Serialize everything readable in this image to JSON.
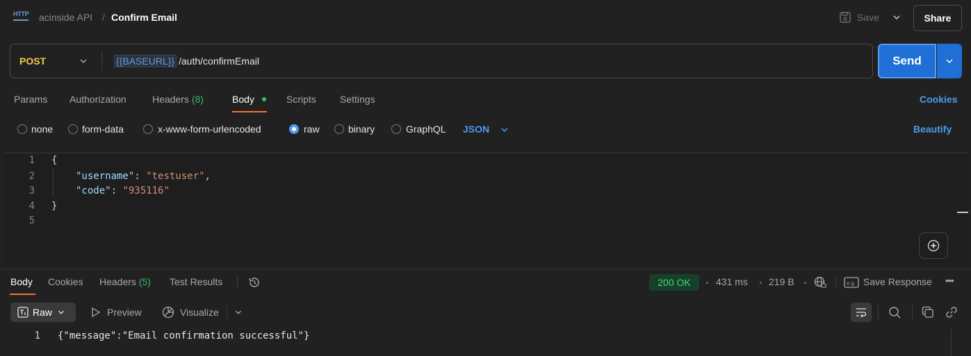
{
  "header": {
    "protocol_badge": "HTTP",
    "collection": "acinside API",
    "separator": "/",
    "request_name": "Confirm Email",
    "save_label": "Save",
    "share_label": "Share"
  },
  "url_bar": {
    "method": "POST",
    "variable": "{{BASEURL}}",
    "path": "/auth/confirmEmail",
    "send_label": "Send"
  },
  "request_tabs": {
    "params": "Params",
    "authorization": "Authorization",
    "headers": "Headers",
    "headers_count": "(8)",
    "body": "Body",
    "scripts": "Scripts",
    "settings": "Settings",
    "cookies": "Cookies"
  },
  "body_types": {
    "none": "none",
    "form_data": "form-data",
    "urlencoded": "x-www-form-urlencoded",
    "raw": "raw",
    "binary": "binary",
    "graphql": "GraphQL",
    "selected": "raw",
    "language": "JSON",
    "beautify": "Beautify"
  },
  "editor": {
    "line_numbers": [
      "1",
      "2",
      "3",
      "4",
      "5"
    ],
    "open_brace": "{",
    "username_key": "\"username\"",
    "username_colon": ": ",
    "username_value": "\"testuser\"",
    "comma": ",",
    "code_key": "\"code\"",
    "code_colon": ": ",
    "code_value": "\"935116\"",
    "close_brace": "}"
  },
  "response_tabs": {
    "body": "Body",
    "cookies": "Cookies",
    "headers": "Headers",
    "headers_count": "(5)",
    "test_results": "Test Results"
  },
  "response_meta": {
    "status": "200 OK",
    "time": "431 ms",
    "size": "219 B",
    "save_response": "Save Response",
    "more": "•••"
  },
  "response_toolbar": {
    "raw": "Raw",
    "preview": "Preview",
    "visualize": "Visualize"
  },
  "response_body": {
    "line_number": "1",
    "content": "{\"message\":\"Email confirmation successful\"}"
  },
  "colors": {
    "accent_orange": "#ff6c37",
    "send_blue": "#1f6fd6",
    "link_blue": "#4d9bf0",
    "status_green": "#3fd680",
    "method_yellow": "#f2c94c"
  }
}
